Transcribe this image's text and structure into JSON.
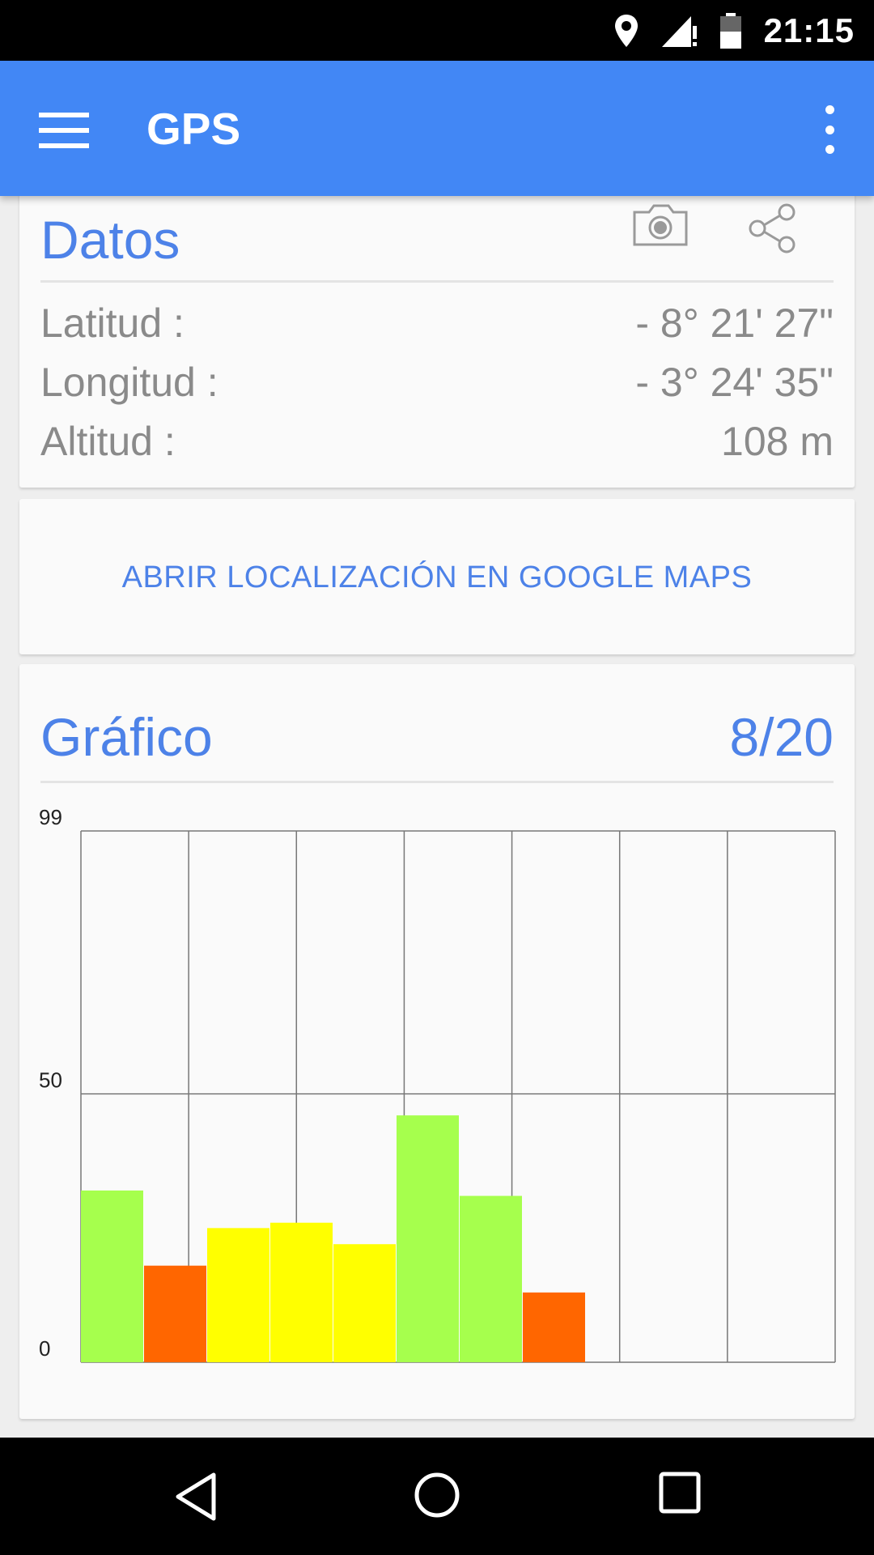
{
  "status_bar": {
    "time": "21:15",
    "icons": [
      "location-icon",
      "signal-icon",
      "battery-icon"
    ]
  },
  "app_bar": {
    "title": "GPS",
    "menu_icon": "hamburger-menu-icon",
    "overflow_icon": "more-vert-icon"
  },
  "datos": {
    "title": "Datos",
    "camera_icon": "camera-icon",
    "share_icon": "share-icon",
    "rows": [
      {
        "label": "Latitud :",
        "value": "- 8° 21' 27\""
      },
      {
        "label": "Longitud :",
        "value": "- 3° 24' 35\""
      },
      {
        "label": "Altitud :",
        "value": "108 m"
      }
    ]
  },
  "maps_link": {
    "label": "ABRIR LOCALIZACIÓN EN GOOGLE MAPS"
  },
  "grafico": {
    "title": "Gráfico",
    "counter": "8/20"
  },
  "chart_data": {
    "type": "bar",
    "ylim": [
      0,
      99
    ],
    "y_ticks": [
      "99",
      "50",
      "0"
    ],
    "grid": true,
    "values": [
      32,
      18,
      25,
      26,
      22,
      46,
      31,
      13
    ],
    "colors": [
      "#a6ff4d",
      "#ff6600",
      "#ffff00",
      "#ffff00",
      "#ffff00",
      "#a6ff4d",
      "#a6ff4d",
      "#ff6600"
    ]
  },
  "nav_bar": {
    "back_icon": "back-icon",
    "home_icon": "home-icon",
    "recents_icon": "recents-icon"
  },
  "colors": {
    "accent": "#4287f5",
    "text_blue": "#4d82e8"
  }
}
